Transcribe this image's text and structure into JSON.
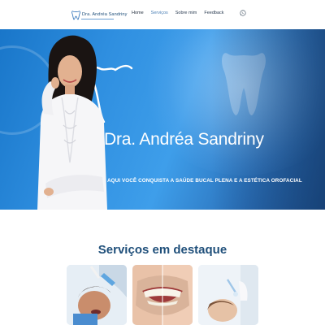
{
  "header": {
    "logo_text": "Dra. Andréa Sandriny",
    "nav": [
      {
        "label": "Home"
      },
      {
        "label": "Serviços"
      },
      {
        "label": "Sobre mim"
      },
      {
        "label": "Feedback"
      }
    ],
    "whatsapp_icon": "whatsapp-icon"
  },
  "hero": {
    "title": "Dra. Andréa Sandriny",
    "subtitle": "AQUI VOCÊ CONQUISTA A SAÚDE BUCAL PLENA E A ESTÉTICA OROFACIAL"
  },
  "services": {
    "title": "Serviços em destaque",
    "cards": [
      {
        "image": "patient-dental-exam-image"
      },
      {
        "image": "smile-whitening-image"
      },
      {
        "image": "facial-aesthetics-image"
      }
    ]
  },
  "colors": {
    "brand_blue": "#1f4f7a",
    "hero_blue": "#2f8fe0"
  }
}
